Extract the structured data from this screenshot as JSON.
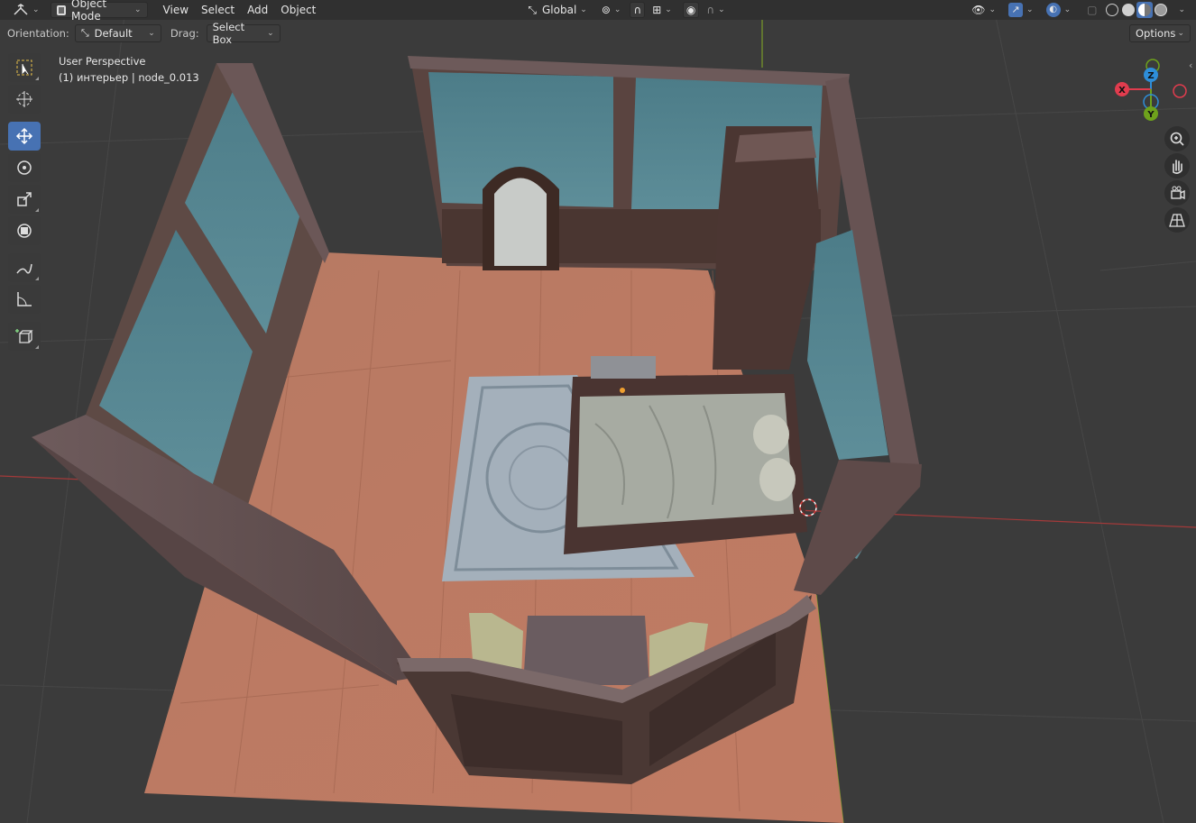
{
  "header": {
    "editor_type_icon": "3d-viewport-icon",
    "mode": "Object Mode",
    "menus": [
      "View",
      "Select",
      "Add",
      "Object"
    ],
    "transform_orientation": "Global",
    "pivot_icon": "pivot-icon",
    "snap_icon": "magnet-snap-icon",
    "proportional_icon": "proportional-edit-icon",
    "right_icons": [
      "visibility-icon",
      "gizmo-icon",
      "overlay-icon",
      "xray-icon",
      "wireframe-shading-icon",
      "solid-shading-icon",
      "material-shading-icon",
      "rendered-shading-icon"
    ]
  },
  "tool_options": {
    "orientation_label": "Orientation:",
    "orientation_value": "Default",
    "drag_label": "Drag:",
    "drag_value": "Select Box",
    "options_label": "Options"
  },
  "toolbar": {
    "tools": [
      {
        "name": "select-box-tool",
        "icon": "select-box-icon",
        "active": false
      },
      {
        "name": "cursor-tool",
        "icon": "cursor-icon",
        "active": false
      },
      {
        "name": "move-tool",
        "icon": "move-icon",
        "active": true
      },
      {
        "name": "rotate-tool",
        "icon": "rotate-icon",
        "active": false
      },
      {
        "name": "scale-tool",
        "icon": "scale-icon",
        "active": false
      },
      {
        "name": "transform-tool",
        "icon": "transform-icon",
        "active": false
      },
      {
        "name": "annotate-tool",
        "icon": "annotate-icon",
        "active": false
      },
      {
        "name": "measure-tool",
        "icon": "measure-icon",
        "active": false
      },
      {
        "name": "add-cube-tool",
        "icon": "add-cube-icon",
        "active": false
      }
    ]
  },
  "viewport": {
    "view_name": "User Perspective",
    "object_info": "(1) интерьер | node_0.013"
  },
  "gizmo": {
    "x_label": "X",
    "y_label": "Y",
    "z_label": "Z",
    "x_color": "#e13c4e",
    "y_color": "#6ea21c",
    "z_color": "#2e8ed9"
  },
  "nav_buttons": [
    "zoom-icon",
    "hand-pan-icon",
    "camera-icon",
    "grid-ortho-icon"
  ],
  "colors": {
    "accent": "#4772b3",
    "header_bg": "#303030",
    "viewport_bg": "#3b3b3b",
    "floor": "#b8735c",
    "wall_blue": "#4f7f8c",
    "wood": "#4a3631"
  }
}
